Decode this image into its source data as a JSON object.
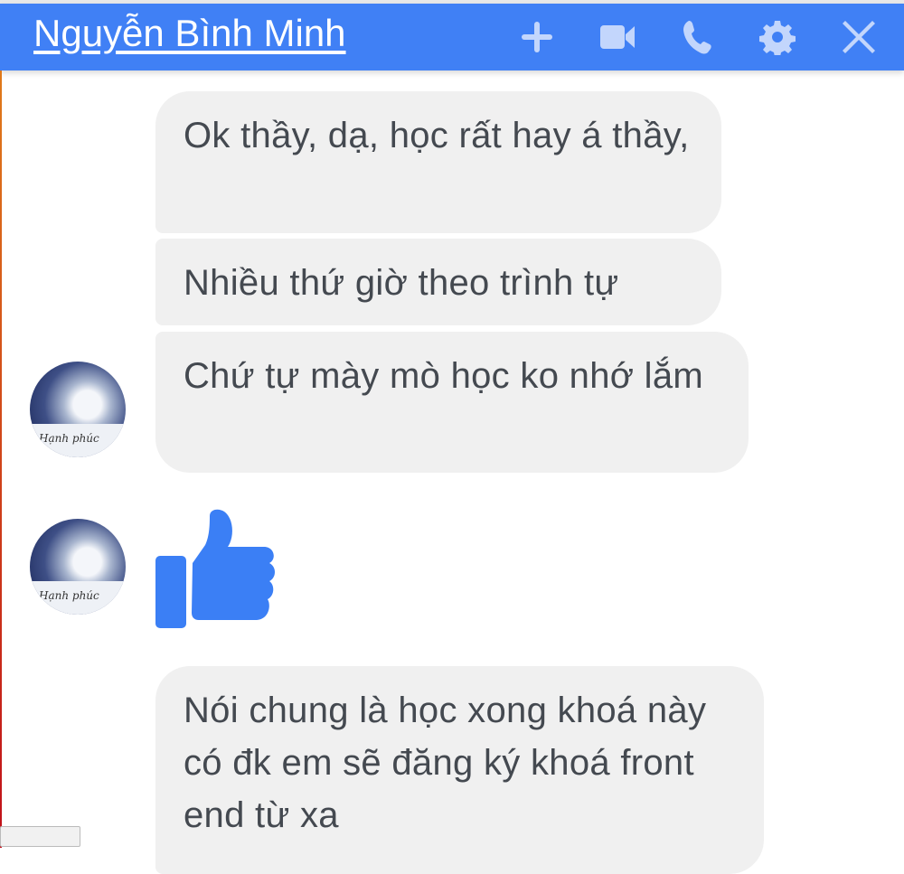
{
  "header": {
    "title": "Nguyễn Bình Minh",
    "icons": [
      "plus-icon",
      "video-camera-icon",
      "phone-icon",
      "gear-icon",
      "close-icon"
    ],
    "background_color": "#4080f5"
  },
  "messages": [
    {
      "text": "Ok thầy, dạ, học rất hay á thầy,"
    },
    {
      "text": "Nhiều thứ giờ theo trình tự"
    },
    {
      "text": "Chứ tự mày mò học ko nhớ lắm"
    },
    {
      "type": "like",
      "icon": "thumbs-up-icon"
    },
    {
      "text": "Nói chung là học xong khoá này có đk em sẽ đăng ký khoá front end từ xa"
    }
  ],
  "avatar": {
    "caption": "Hạnh phúc"
  },
  "accent_color": "#3b7ff5"
}
